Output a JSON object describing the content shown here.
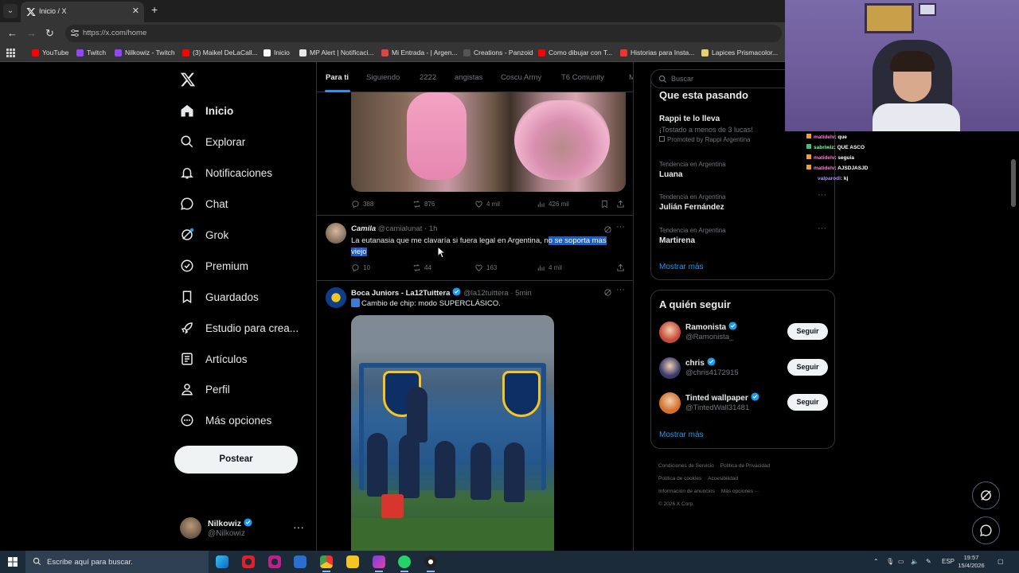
{
  "browser": {
    "tab_title": "Inicio / X",
    "url": "https://x.com/home",
    "bookmarks": [
      {
        "label": "YouTube",
        "color": "#ff0000"
      },
      {
        "label": "Twitch",
        "color": "#9146ff"
      },
      {
        "label": "Nilkowiz - Twitch",
        "color": "#9146ff"
      },
      {
        "label": "(3) Maikel DeLaCall...",
        "color": "#ff0000"
      },
      {
        "label": "Inicio",
        "color": "#ffffff"
      },
      {
        "label": "MP Alert | Notificaci...",
        "color": "#e8e8e8"
      },
      {
        "label": "Mi Entrada - | Argen...",
        "color": "#d44"
      },
      {
        "label": "Creations - Panzoid",
        "color": "#555"
      },
      {
        "label": "Como dibujar con T...",
        "color": "#ff0000"
      },
      {
        "label": "Historias para Insta...",
        "color": "#e33"
      },
      {
        "label": "Lapices Prismacolor...",
        "color": "#e8d070"
      }
    ]
  },
  "nav": {
    "items": [
      {
        "label": "Inicio",
        "icon": "home-icon"
      },
      {
        "label": "Explorar",
        "icon": "search-icon"
      },
      {
        "label": "Notificaciones",
        "icon": "bell-icon"
      },
      {
        "label": "Chat",
        "icon": "chat-icon"
      },
      {
        "label": "Grok",
        "icon": "grok-icon"
      },
      {
        "label": "Premium",
        "icon": "premium-icon"
      },
      {
        "label": "Guardados",
        "icon": "bookmark-icon"
      },
      {
        "label": "Estudio para crea...",
        "icon": "rocket-icon"
      },
      {
        "label": "Artículos",
        "icon": "article-icon"
      },
      {
        "label": "Perfil",
        "icon": "person-icon"
      },
      {
        "label": "Más opciones",
        "icon": "more-circle-icon"
      }
    ],
    "post_label": "Postear",
    "account": {
      "name": "Nilkowiz",
      "handle": "@Nilkowiz"
    }
  },
  "timeline": {
    "tabs": [
      "Para ti",
      "Siguiendo",
      "2222",
      "angistas",
      "Coscu Army",
      "T6 Comunity",
      "M"
    ],
    "active_tab": "Para ti",
    "first_actions": {
      "replies": "388",
      "reposts": "876",
      "likes": "4 mil",
      "views": "426 mil"
    },
    "tweet1": {
      "name": "Camila",
      "handle": "@camialunat",
      "time": "· 1h",
      "text_plain": "La eutanasia que me clavaría si fuera legal en Argentina, n",
      "text_selected_1": "o se soporta mas",
      "text_selected_2": "viejo",
      "actions": {
        "replies": "10",
        "reposts": "44",
        "likes": "163",
        "views": "4 mil"
      }
    },
    "tweet2": {
      "name": "Boca Juniors - La12Tuittera",
      "handle": "@la12tuittera",
      "time": "· 5min",
      "text": "Cambio de chip: modo SUPERCLÁSICO."
    }
  },
  "sidebar": {
    "search_placeholder": "Buscar",
    "trends_title": "Que esta pasando",
    "promoted": {
      "name": "Rappi te lo lleva",
      "sub": "¡Tostado a menos de 3 lucas!",
      "promo": "Promoted by Rappi Argentina"
    },
    "trends": [
      {
        "context": "Tendencia en Argentina",
        "name": "Luana"
      },
      {
        "context": "Tendencia en Argentina",
        "name": "Julián Fernández"
      },
      {
        "context": "Tendencia en Argentina",
        "name": "Martirena"
      }
    ],
    "show_more": "Mostrar más",
    "follow_title": "A quién seguir",
    "follow": [
      {
        "name": "Ramonista",
        "handle": "@Ramonista_",
        "button": "Seguir",
        "color": "#c84a3a"
      },
      {
        "name": "chris",
        "handle": "@chris4172915",
        "button": "Seguir",
        "color": "#3a3a6a"
      },
      {
        "name": "Tinted wallpaper",
        "handle": "@TintedWall31481",
        "button": "Seguir",
        "color": "#d4702a"
      }
    ],
    "follow_show_more": "Mostrar más",
    "footer": [
      "Condiciones de Servicio",
      "Política de Privacidad",
      "Política de cookies",
      "Accesibilidad",
      "Información de anuncios",
      "Más opciones ···",
      "© 2026 X Corp."
    ]
  },
  "stream_chat": [
    {
      "user": "matidelv",
      "msg": ": que"
    },
    {
      "user": "sabriwiz",
      "msg": ": QUE ASCO"
    },
    {
      "user": "matidelv",
      "msg": ": seguia"
    },
    {
      "user": "matidelv",
      "msg": ": AJSDJASJD"
    },
    {
      "user": "valparodi",
      "msg": ": kj"
    }
  ],
  "taskbar": {
    "search_placeholder": "Escribe aquí para buscar.",
    "lang": "ESP",
    "time": "19:57",
    "date": "15/4/2026"
  },
  "colors": {
    "accent": "#1d9bf0",
    "background": "#000000",
    "border": "#2f3336"
  }
}
